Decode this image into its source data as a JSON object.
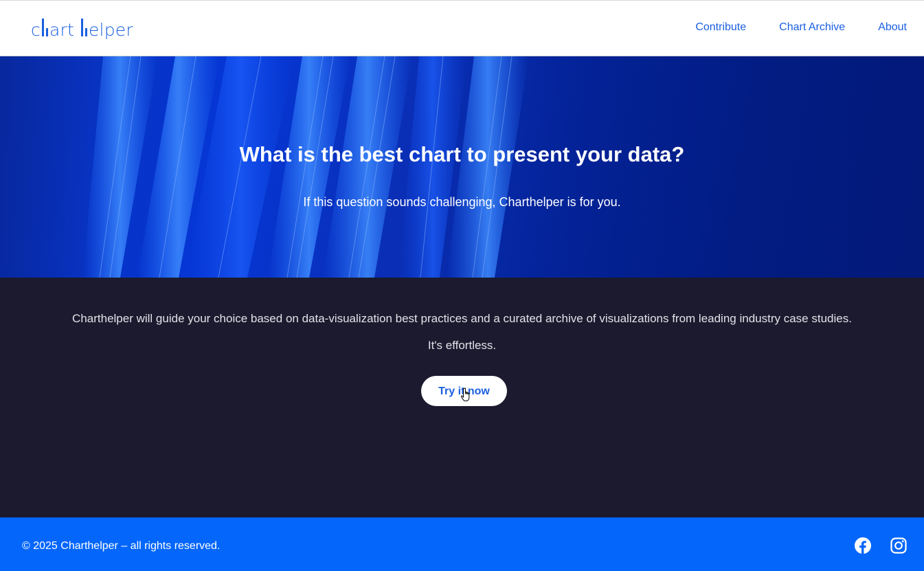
{
  "header": {
    "logo": {
      "part1": "c",
      "part2": "art",
      "part3": "elper",
      "color": "#1a5fe0"
    },
    "nav": [
      {
        "label": "Contribute"
      },
      {
        "label": "Chart Archive"
      },
      {
        "label": "About"
      }
    ]
  },
  "hero": {
    "title": "What is the best chart to present your data?",
    "subtitle": "If this question sounds challenging, Charthelper is for you."
  },
  "intro": {
    "text": "Charthelper will guide your choice based on data-visualization best practices and a curated archive of visualizations from leading industry case studies.",
    "text2": "It's effortless.",
    "cta_label": "Try it now"
  },
  "footer": {
    "copyright": "© 2025 Charthelper – all rights reserved.",
    "social": [
      {
        "icon": "facebook-icon"
      },
      {
        "icon": "instagram-icon"
      }
    ],
    "background": "#0466fb"
  },
  "colors": {
    "accent": "#1a5fe0",
    "hero_dark": "#031a7a",
    "section_dark": "#1b1a2e"
  }
}
